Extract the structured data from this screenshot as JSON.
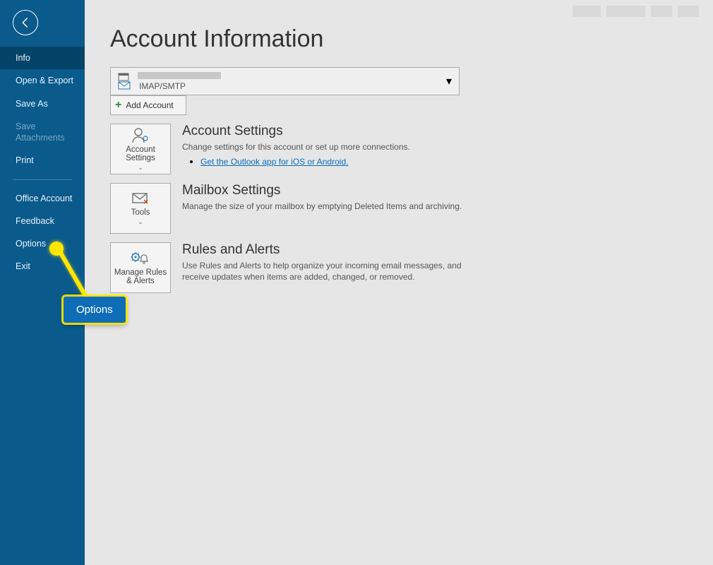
{
  "sidebar": {
    "items": [
      {
        "label": "Info",
        "selected": true
      },
      {
        "label": "Open & Export"
      },
      {
        "label": "Save As"
      },
      {
        "label": "Save Attachments",
        "disabled": true
      },
      {
        "label": "Print"
      }
    ],
    "items2": [
      {
        "label": "Office Account"
      },
      {
        "label": "Feedback"
      },
      {
        "label": "Options"
      },
      {
        "label": "Exit"
      }
    ]
  },
  "page": {
    "title": "Account Information"
  },
  "account": {
    "type": "IMAP/SMTP",
    "add_label": "Add Account"
  },
  "sections": {
    "account_settings": {
      "tile": "Account Settings",
      "heading": "Account Settings",
      "desc": "Change settings for this account or set up more connections.",
      "link": "Get the Outlook app for iOS or Android."
    },
    "mailbox": {
      "tile": "Tools",
      "heading": "Mailbox Settings",
      "desc": "Manage the size of your mailbox by emptying Deleted Items and archiving."
    },
    "rules": {
      "tile": "Manage Rules & Alerts",
      "heading": "Rules and Alerts",
      "desc": "Use Rules and Alerts to help organize your incoming email messages, and receive updates when items are added, changed, or removed."
    }
  },
  "callout": {
    "label": "Options"
  }
}
